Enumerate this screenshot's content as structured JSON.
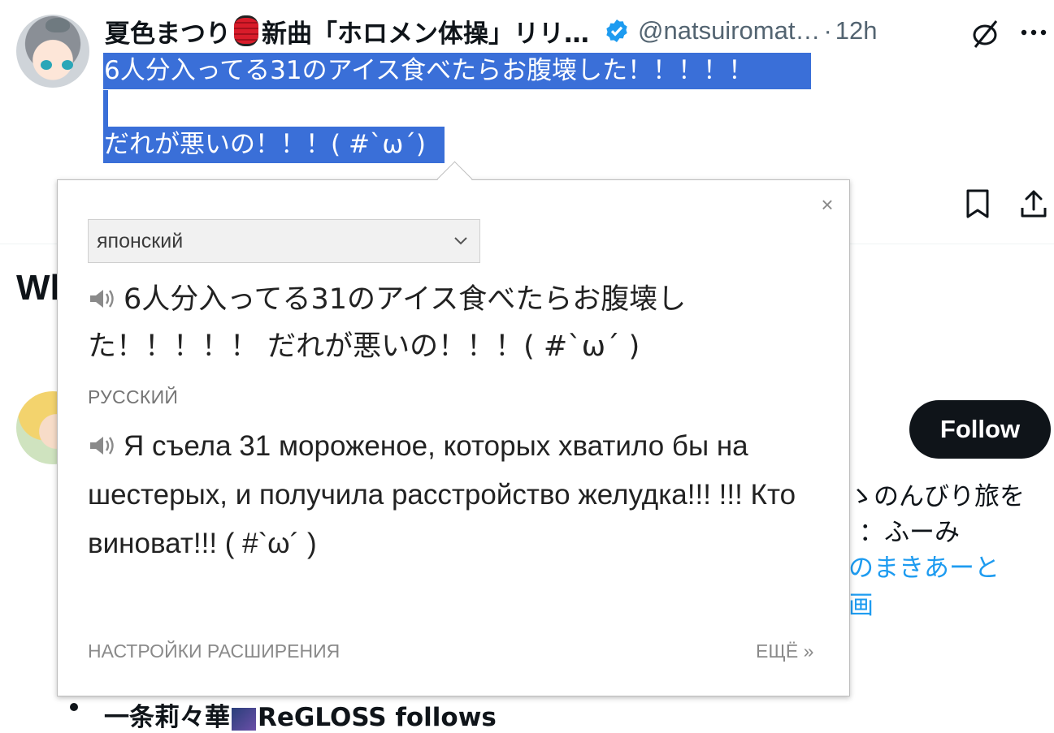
{
  "tweet": {
    "author_name_part1": "夏色まつり",
    "author_name_part2": "新曲「ホロメン体操」リリ…",
    "handle": "@natsuiromat…",
    "separator": "·",
    "time": "12h",
    "text_line1": "6人分入ってる31のアイス食べたらお腹壊した！！！！！",
    "text_line3": "だれが悪いの！！！( #`ω´)"
  },
  "sidebar_section": {
    "title_partial": "Wl",
    "follow_label": "Follow",
    "bio_line1": "ゝのんびり旅を",
    "bio_line2": "：ふーみ",
    "bio_line3": "のまきあーと",
    "bio_line4": "画",
    "list_text_part1": "一条莉々華",
    "list_text_part2": "ReGLOSS follows"
  },
  "translator": {
    "close_symbol": "×",
    "source_language": "японский",
    "source_text": "6人分入ってる31のアイス食べたらお腹壊した！！！！！ だれが悪いの！！！( #`ω´ )",
    "target_language": "РУССКИЙ",
    "target_text": "Я съела 31 мороженое, которых хватило бы на шестерых, и получила расстройство желудка!!! !!! Кто виноват!!! ( #`ω´ )",
    "settings_label": "НАСТРОЙКИ РАСШИРЕНИЯ",
    "more_label": "ЕЩЁ »"
  },
  "colors": {
    "selection": "#3a6fd8",
    "verified": "#1d9bf0",
    "link": "#1d9bf0",
    "follow_bg": "#0f1419"
  },
  "icons": [
    "verified-badge-icon",
    "grok-disabled-icon",
    "more-icon",
    "bookmark-icon",
    "share-icon",
    "close-icon",
    "chevron-down-icon",
    "speaker-icon"
  ]
}
